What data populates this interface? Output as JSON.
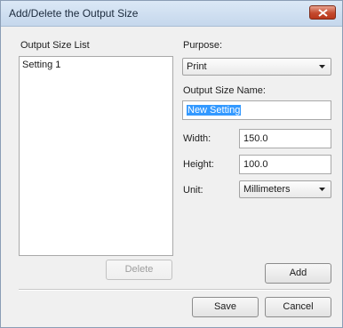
{
  "window": {
    "title": "Add/Delete the Output Size"
  },
  "list": {
    "label": "Output Size List",
    "items": [
      "Setting 1"
    ]
  },
  "purpose": {
    "label": "Purpose:",
    "value": "Print"
  },
  "output_size_name": {
    "label": "Output Size Name:",
    "value": "New Setting"
  },
  "width": {
    "label": "Width:",
    "value": "150.0"
  },
  "height": {
    "label": "Height:",
    "value": "100.0"
  },
  "unit": {
    "label": "Unit:",
    "value": "Millimeters"
  },
  "buttons": {
    "delete": "Delete",
    "add": "Add",
    "save": "Save",
    "cancel": "Cancel"
  },
  "icons": {
    "close": "close-icon",
    "dropdown": "chevron-down-icon"
  },
  "colors": {
    "close_button": "#c44a2e",
    "selection": "#3399ff"
  }
}
